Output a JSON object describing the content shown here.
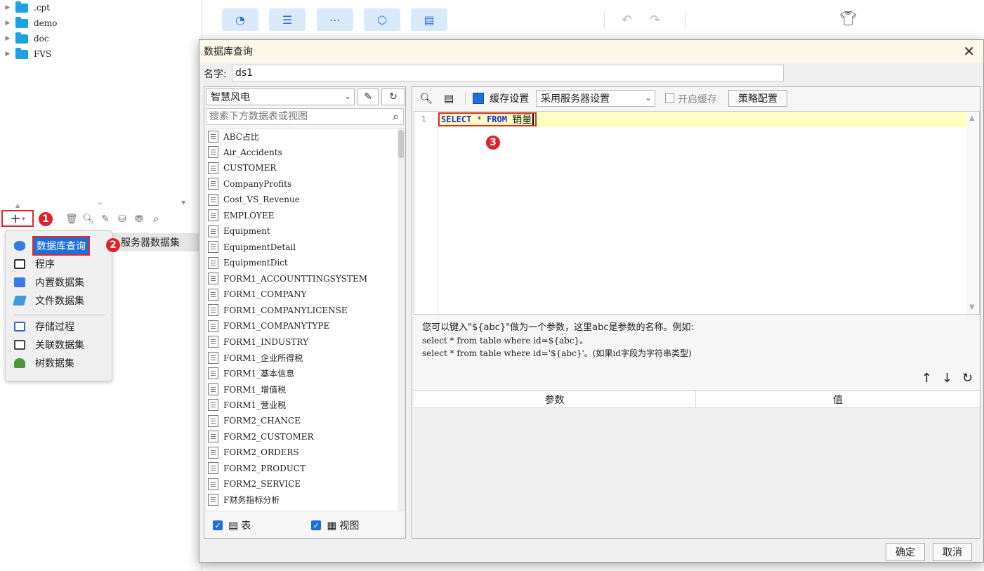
{
  "tree": {
    "folders": [
      ".cpt",
      "demo",
      "doc",
      "FVS"
    ]
  },
  "left_toolbar": {
    "add_symbol": "+",
    "add_caret": "▾"
  },
  "server_dataset_label": "服务器数据集",
  "add_menu": {
    "items": [
      {
        "label": "数据库查询",
        "icon": "database-icon",
        "color": "#3b7be8"
      },
      {
        "label": "程序",
        "icon": "monitor-icon",
        "color": "#333333"
      },
      {
        "label": "内置数据集",
        "icon": "builtin-dataset-icon",
        "color": "#3b7be8"
      },
      {
        "label": "文件数据集",
        "icon": "file-dataset-icon",
        "color": "#3b9be0"
      },
      {
        "label": "存储过程",
        "icon": "procedure-icon",
        "color": "#2a6fc9"
      },
      {
        "label": "关联数据集",
        "icon": "relation-dataset-icon",
        "color": "#444444"
      },
      {
        "label": "树数据集",
        "icon": "tree-dataset-icon",
        "color": "#4a9a3a"
      }
    ]
  },
  "badges": [
    "1",
    "2",
    "3"
  ],
  "dialog": {
    "title": "数据库查询",
    "close_symbol": "✕",
    "name_label": "名字:",
    "name_value": "ds1",
    "database": "智慧风电",
    "search_placeholder": "搜索下方数据表或视图",
    "tables": [
      "ABC占比",
      "Air_Accidents",
      "CUSTOMER",
      "CompanyProfits",
      "Cost_VS_Revenue",
      "EMPLOYEE",
      "Equipment",
      "EquipmentDetail",
      "EquipmentDict",
      "FORM1_ACCOUNTTINGSYSTEM",
      "FORM1_COMPANY",
      "FORM1_COMPANYLICENSE",
      "FORM1_COMPANYTYPE",
      "FORM1_INDUSTRY",
      "FORM1_企业所得税",
      "FORM1_基本信息",
      "FORM1_增值税",
      "FORM1_营业税",
      "FORM2_CHANCE",
      "FORM2_CUSTOMER",
      "FORM2_ORDERS",
      "FORM2_PRODUCT",
      "FORM2_SERVICE",
      "F财务指标分析"
    ],
    "footer_table_label": "表",
    "footer_view_label": "视图",
    "cache_label": "缓存设置",
    "cache_option": "采用服务器设置",
    "enable_cache_label": "开启缓存",
    "strategy_button": "策略配置",
    "line_number": "1",
    "sql": {
      "select": "SELECT",
      "star": "*",
      "from": "FROM",
      "table": "销量"
    },
    "hint_line1": "您可以键入\"${abc}\"做为一个参数，这里abc是参数的名称。例如:",
    "hint_line2": "select * from table where id=${abc}。",
    "hint_line3": "select * from table where id='${abc}'。(如果id字段为字符串类型)",
    "param_header": "参数",
    "value_header": "值",
    "ok_button": "确定",
    "cancel_button": "取消"
  }
}
